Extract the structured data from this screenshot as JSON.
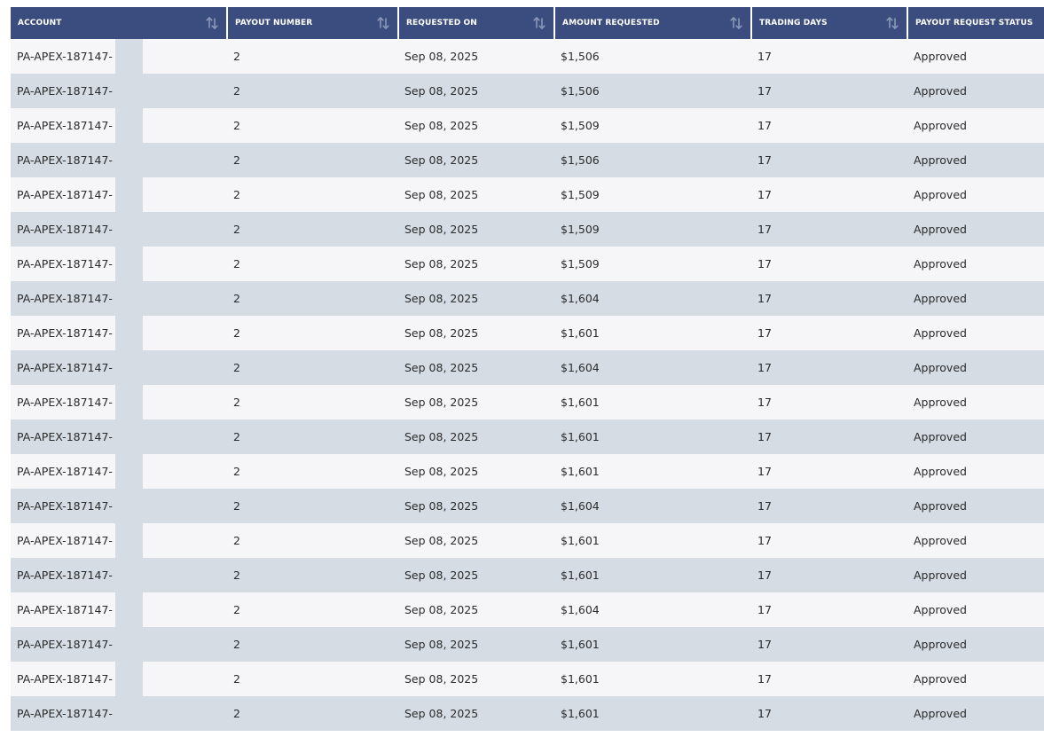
{
  "colors": {
    "header_bg": "#3a4d7e",
    "header_text": "#ffffff",
    "row_light": "#f6f6f8",
    "row_dark": "#d5dce3",
    "text": "#2b2b2b",
    "sort_icon": "#8a97b8"
  },
  "table": {
    "columns": [
      {
        "key": "account",
        "label": "ACCOUNT",
        "sortable": true,
        "icon": "sort-arrows-icon"
      },
      {
        "key": "payout_number",
        "label": "PAYOUT NUMBER",
        "sortable": true,
        "icon": "sort-arrows-icon"
      },
      {
        "key": "requested_on",
        "label": "REQUESTED ON",
        "sortable": true,
        "icon": "sort-arrows-icon"
      },
      {
        "key": "amount_requested",
        "label": "AMOUNT REQUESTED",
        "sortable": true,
        "icon": "sort-arrows-icon"
      },
      {
        "key": "trading_days",
        "label": "TRADING DAYS",
        "sortable": true,
        "icon": "sort-arrows-icon"
      },
      {
        "key": "status",
        "label": "PAYOUT REQUEST STATUS",
        "sortable": false
      }
    ],
    "rows": [
      {
        "account": "PA-APEX-187147-",
        "payout_number": "2",
        "requested_on": "Sep 08, 2025",
        "amount_requested": "$1,506",
        "trading_days": "17",
        "status": "Approved"
      },
      {
        "account": "PA-APEX-187147-",
        "payout_number": "2",
        "requested_on": "Sep 08, 2025",
        "amount_requested": "$1,506",
        "trading_days": "17",
        "status": "Approved"
      },
      {
        "account": "PA-APEX-187147-",
        "payout_number": "2",
        "requested_on": "Sep 08, 2025",
        "amount_requested": "$1,509",
        "trading_days": "17",
        "status": "Approved"
      },
      {
        "account": "PA-APEX-187147-",
        "payout_number": "2",
        "requested_on": "Sep 08, 2025",
        "amount_requested": "$1,506",
        "trading_days": "17",
        "status": "Approved"
      },
      {
        "account": "PA-APEX-187147-",
        "payout_number": "2",
        "requested_on": "Sep 08, 2025",
        "amount_requested": "$1,509",
        "trading_days": "17",
        "status": "Approved"
      },
      {
        "account": "PA-APEX-187147-",
        "payout_number": "2",
        "requested_on": "Sep 08, 2025",
        "amount_requested": "$1,509",
        "trading_days": "17",
        "status": "Approved"
      },
      {
        "account": "PA-APEX-187147-",
        "payout_number": "2",
        "requested_on": "Sep 08, 2025",
        "amount_requested": "$1,509",
        "trading_days": "17",
        "status": "Approved"
      },
      {
        "account": "PA-APEX-187147-",
        "payout_number": "2",
        "requested_on": "Sep 08, 2025",
        "amount_requested": "$1,604",
        "trading_days": "17",
        "status": "Approved"
      },
      {
        "account": "PA-APEX-187147-",
        "payout_number": "2",
        "requested_on": "Sep 08, 2025",
        "amount_requested": "$1,601",
        "trading_days": "17",
        "status": "Approved"
      },
      {
        "account": "PA-APEX-187147-",
        "payout_number": "2",
        "requested_on": "Sep 08, 2025",
        "amount_requested": "$1,604",
        "trading_days": "17",
        "status": "Approved"
      },
      {
        "account": "PA-APEX-187147-",
        "payout_number": "2",
        "requested_on": "Sep 08, 2025",
        "amount_requested": "$1,601",
        "trading_days": "17",
        "status": "Approved"
      },
      {
        "account": "PA-APEX-187147-",
        "payout_number": "2",
        "requested_on": "Sep 08, 2025",
        "amount_requested": "$1,601",
        "trading_days": "17",
        "status": "Approved"
      },
      {
        "account": "PA-APEX-187147-",
        "payout_number": "2",
        "requested_on": "Sep 08, 2025",
        "amount_requested": "$1,601",
        "trading_days": "17",
        "status": "Approved"
      },
      {
        "account": "PA-APEX-187147-",
        "payout_number": "2",
        "requested_on": "Sep 08, 2025",
        "amount_requested": "$1,604",
        "trading_days": "17",
        "status": "Approved"
      },
      {
        "account": "PA-APEX-187147-",
        "payout_number": "2",
        "requested_on": "Sep 08, 2025",
        "amount_requested": "$1,601",
        "trading_days": "17",
        "status": "Approved"
      },
      {
        "account": "PA-APEX-187147-",
        "payout_number": "2",
        "requested_on": "Sep 08, 2025",
        "amount_requested": "$1,601",
        "trading_days": "17",
        "status": "Approved"
      },
      {
        "account": "PA-APEX-187147-",
        "payout_number": "2",
        "requested_on": "Sep 08, 2025",
        "amount_requested": "$1,604",
        "trading_days": "17",
        "status": "Approved"
      },
      {
        "account": "PA-APEX-187147-",
        "payout_number": "2",
        "requested_on": "Sep 08, 2025",
        "amount_requested": "$1,601",
        "trading_days": "17",
        "status": "Approved"
      },
      {
        "account": "PA-APEX-187147-",
        "payout_number": "2",
        "requested_on": "Sep 08, 2025",
        "amount_requested": "$1,601",
        "trading_days": "17",
        "status": "Approved"
      },
      {
        "account": "PA-APEX-187147-",
        "payout_number": "2",
        "requested_on": "Sep 08, 2025",
        "amount_requested": "$1,601",
        "trading_days": "17",
        "status": "Approved"
      }
    ]
  }
}
